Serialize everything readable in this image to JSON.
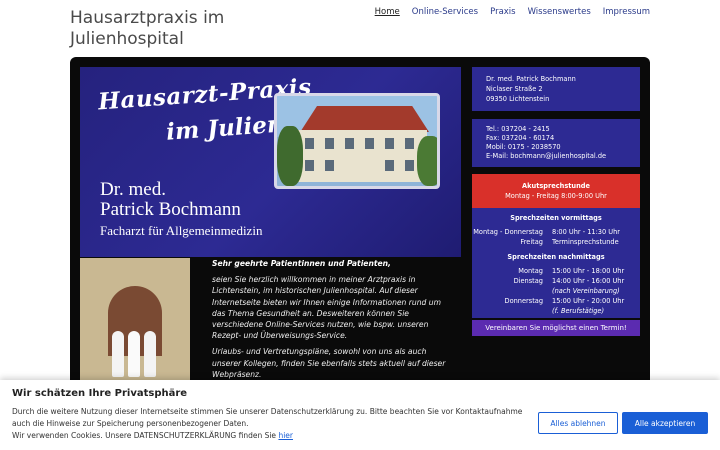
{
  "site": {
    "title": "Hausarztpraxis im Julienhospital"
  },
  "nav": [
    {
      "label": "Home",
      "active": true
    },
    {
      "label": "Online-Services"
    },
    {
      "label": "Praxis"
    },
    {
      "label": "Wissenswertes"
    },
    {
      "label": "Impressum"
    }
  ],
  "banner": {
    "line1": "Hausarzt-Praxis",
    "line2": "im Julienhospital",
    "name1": "Dr. med.",
    "name2": "Patrick Bochmann",
    "subtitle": "Facharzt für Allgemeinmedizin"
  },
  "welcome": {
    "heading": "Sehr geehrte Patientinnen und Patienten,",
    "p1": "seien Sie herzlich willkommen in meiner Arztpraxis in Lichtenstein, im historischen Julienhospital. Auf dieser Internetseite bieten wir Ihnen einige Informationen rund um das Thema Gesundheit an. Desweiteren können Sie verschiedene Online-Services nutzen, wie bspw. unseren Rezept- und Überweisungs-Service.",
    "p2": "Urlaubs- und Vertretungspläne, sowohl von uns als auch unserer Kollegen, finden Sie ebenfalls stets aktuell auf dieser Webpräsenz."
  },
  "address": {
    "name": "Dr. med. Patrick Bochmann",
    "street": "Niclaser Straße 2",
    "city": "09350 Lichtenstein"
  },
  "contact": {
    "tel": "Tel.: 037204 - 2415",
    "fax": "Fax: 037204 - 60174",
    "mobil": "Mobil: 0175 - 2038570",
    "email": "E-Mail: bochmann@julienhospital.de"
  },
  "acute": {
    "title": "Akutsprechstunde",
    "time": "Montag - Freitag 8:00-9:00 Uhr"
  },
  "hours": {
    "morning_title": "Sprechzeiten vormittags",
    "morning": [
      {
        "day": "Montag - Donnerstag",
        "time": "8:00 Uhr - 11:30 Uhr"
      },
      {
        "day": "Freitag",
        "time": "Terminsprechstunde"
      }
    ],
    "afternoon_title": "Sprechzeiten nachmittags",
    "afternoon": [
      {
        "day": "Montag",
        "time": "15:00 Uhr - 18:00 Uhr",
        "note": ""
      },
      {
        "day": "Dienstag",
        "time": "14:00 Uhr - 16:00 Uhr",
        "note": "(nach Vereinbarung)"
      },
      {
        "day": "Donnerstag",
        "time": "15:00 Uhr - 20:00 Uhr",
        "note": "(f. Berufstätige)"
      }
    ]
  },
  "cta": "Vereinbaren Sie möglichst einen Termin!",
  "cookie": {
    "title": "Wir schätzen Ihre Privatsphäre",
    "line1": "Durch die weitere Nutzung dieser Internetseite stimmen Sie unserer Datenschutzerklärung zu. Bitte beachten Sie vor Kontaktaufnahme auch die Hinweise zur Speicherung personenbezogener Daten.",
    "line2": "Wir verwenden Cookies. Unsere DATENSCHUTZERKLÄRUNG finden Sie",
    "link": "hier",
    "decline": "Alles ablehnen",
    "accept": "Alle akzeptieren"
  }
}
